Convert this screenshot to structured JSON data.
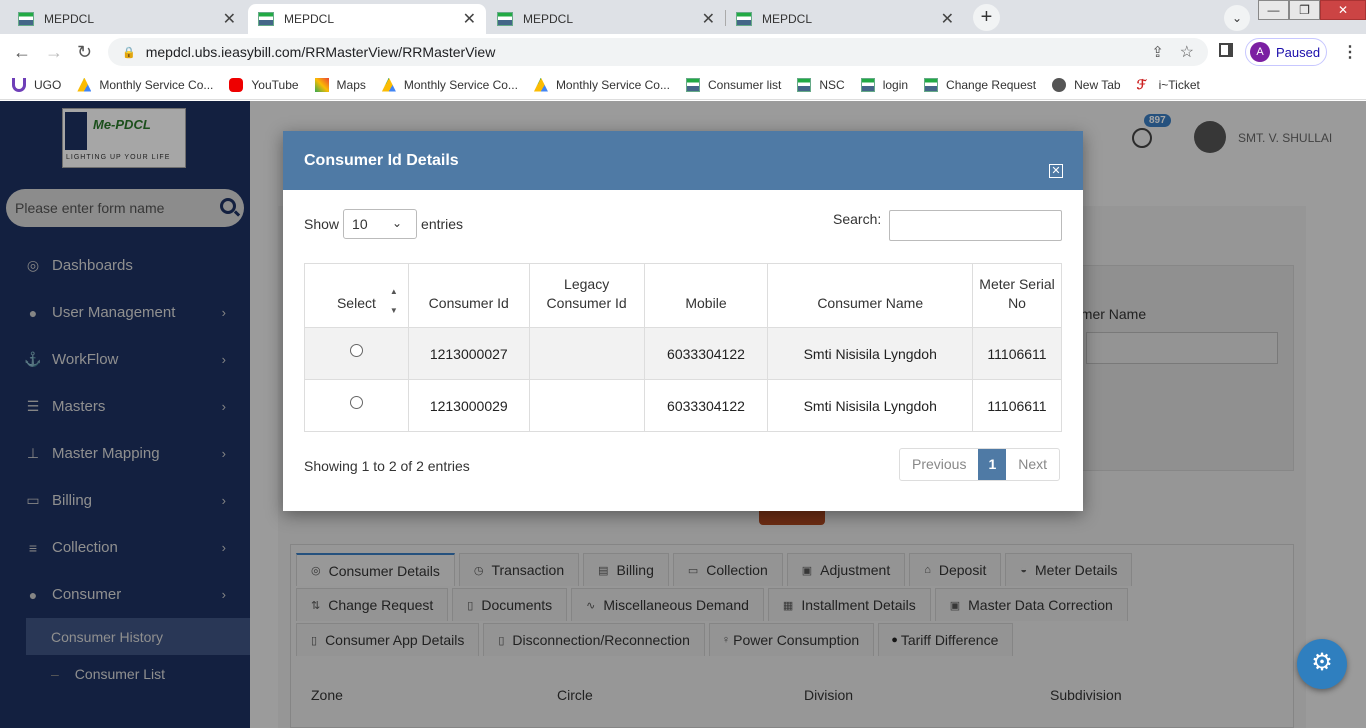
{
  "browser": {
    "tabs": [
      {
        "title": "MEPDCL",
        "active": false
      },
      {
        "title": "MEPDCL",
        "active": true
      },
      {
        "title": "MEPDCL",
        "active": false
      },
      {
        "title": "MEPDCL",
        "active": false
      }
    ],
    "url": "mepdcl.ubs.ieasybill.com/RRMasterView/RRMasterView",
    "profile_initial": "A",
    "profile_status": "Paused",
    "bookmarks": [
      "UGO",
      "Monthly Service Co...",
      "YouTube",
      "Maps",
      "Monthly Service Co...",
      "Monthly Service Co...",
      "Consumer list",
      "NSC",
      "login",
      "Change Request",
      "New Tab",
      "i~Ticket"
    ]
  },
  "sidebar": {
    "logo_text": "Me-PDCL",
    "logo_slogan": "LIGHTING UP YOUR LIFE",
    "search_placeholder": "Please enter form name",
    "menu": [
      {
        "label": "Dashboards",
        "icon": "dashboard-icon"
      },
      {
        "label": "User Management",
        "icon": "user-icon"
      },
      {
        "label": "WorkFlow",
        "icon": "anchor-icon"
      },
      {
        "label": "Masters",
        "icon": "server-icon"
      },
      {
        "label": "Master Mapping",
        "icon": "sitemap-icon"
      },
      {
        "label": "Billing",
        "icon": "monitor-icon"
      },
      {
        "label": "Collection",
        "icon": "list-icon"
      },
      {
        "label": "Consumer",
        "icon": "user-icon"
      }
    ],
    "submenu": [
      "Consumer History",
      "Consumer List"
    ]
  },
  "topbar": {
    "notification_count": "897",
    "user_name": "SMT. V. SHULLAI"
  },
  "background": {
    "field_label": "sumer Name",
    "tabs_row1": [
      "Consumer Details",
      "Transaction",
      "Billing",
      "Collection",
      "Adjustment",
      "Deposit",
      "Meter Details"
    ],
    "tabs_row2": [
      "Change Request",
      "Documents",
      "Miscellaneous Demand",
      "Installment Details",
      "Master Data Correction"
    ],
    "tabs_row3": [
      "Consumer App Details",
      "Disconnection/Reconnection",
      "Power Consumption",
      "Tariff Difference"
    ],
    "columns": [
      "Zone",
      "Circle",
      "Division",
      "Subdivision"
    ]
  },
  "modal": {
    "title": "Consumer Id Details",
    "show_label": "Show",
    "page_length": "10",
    "entries_label": "entries",
    "search_label": "Search:",
    "columns": [
      "Select",
      "Consumer Id",
      "Legacy Consumer Id",
      "Mobile",
      "Consumer Name",
      "Meter Serial No"
    ],
    "rows": [
      {
        "consumer_id": "1213000027",
        "legacy_id": "",
        "mobile": "6033304122",
        "name": "Smti Nisisila Lyngdoh",
        "meter": "11106611"
      },
      {
        "consumer_id": "1213000029",
        "legacy_id": "",
        "mobile": "6033304122",
        "name": "Smti Nisisila Lyngdoh",
        "meter": "11106611"
      }
    ],
    "info": "Showing 1 to 2 of 2 entries",
    "prev_label": "Previous",
    "page": "1",
    "next_label": "Next"
  }
}
